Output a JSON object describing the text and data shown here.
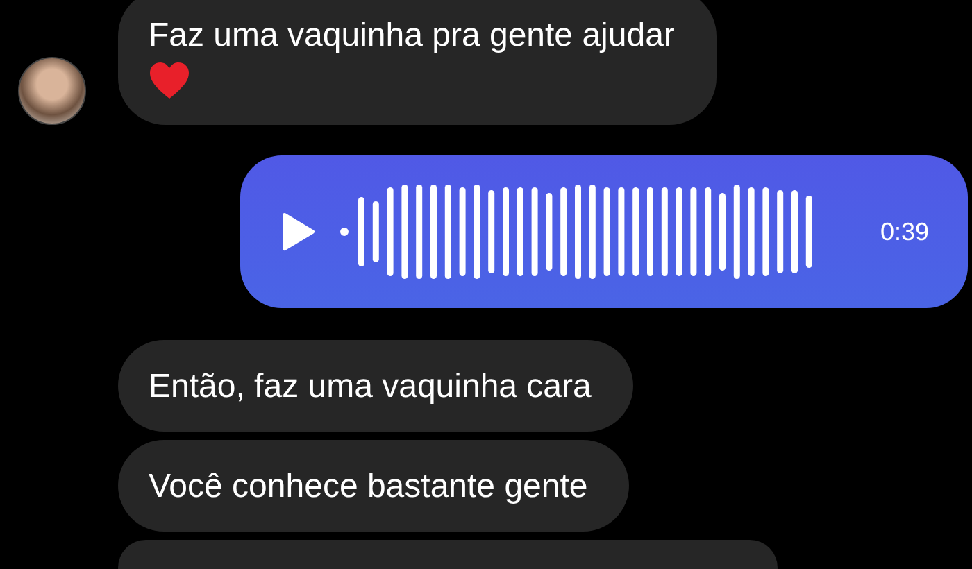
{
  "messages": [
    {
      "kind": "incoming-text",
      "text": "Faz uma vaquinha pra gente ajudar",
      "heart": true,
      "show_avatar": true
    },
    {
      "kind": "outgoing-audio",
      "duration": "0:39"
    },
    {
      "kind": "incoming-text",
      "text": "Então, faz uma vaquinha cara",
      "heart": false,
      "show_avatar": false
    },
    {
      "kind": "incoming-text",
      "text": "Você conhece bastante gente",
      "heart": false,
      "show_avatar": false
    }
  ]
}
